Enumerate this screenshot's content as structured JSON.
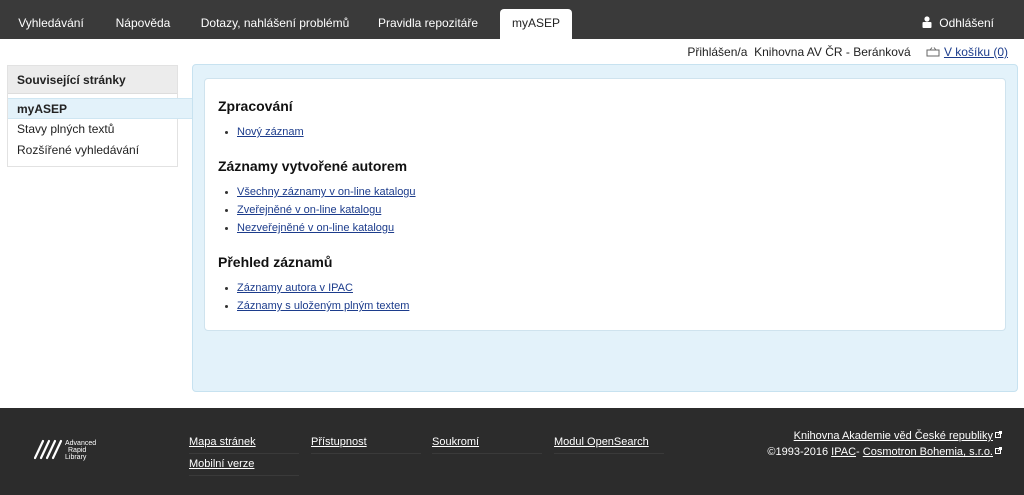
{
  "topnav": {
    "tabs": [
      {
        "label": "Vyhledávání"
      },
      {
        "label": "Nápověda"
      },
      {
        "label": "Dotazy, nahlášení problémů"
      },
      {
        "label": "Pravidla repozitáře"
      },
      {
        "label": "myASEP"
      }
    ],
    "logout_label": "Odhlášení"
  },
  "loginbar": {
    "logged_prefix": "Přihlášen/a",
    "user": "Knihovna AV ČR - Beránková",
    "cart_label": "V košíku (0)"
  },
  "sidebar": {
    "heading": "Související stránky",
    "items": [
      {
        "label": "myASEP"
      },
      {
        "label": "Stavy plných textů"
      },
      {
        "label": "Rozšířené vyhledávání"
      }
    ]
  },
  "main": {
    "sections": [
      {
        "heading": "Zpracování",
        "links": [
          "Nový záznam"
        ]
      },
      {
        "heading": "Záznamy vytvořené autorem",
        "links": [
          "Všechny záznamy v on-line katalogu",
          "Zveřejněné v on-line katalogu",
          "Nezveřejněné v on-line katalogu"
        ]
      },
      {
        "heading": "Přehled záznamů",
        "links": [
          "Záznamy autora v IPAC",
          "Záznamy s uloženým plným textem"
        ]
      }
    ]
  },
  "footer": {
    "logo_text": [
      "Advanced",
      "Rapid",
      "Library"
    ],
    "columns": [
      {
        "links": [
          "Mapa stránek",
          "Mobilní verze"
        ]
      },
      {
        "links": [
          "Přístupnost"
        ]
      },
      {
        "links": [
          "Soukromí"
        ]
      },
      {
        "links": [
          "Modul OpenSearch"
        ]
      }
    ],
    "library_link": "Knihovna Akademie věd České republiky",
    "copyright": "©1993-2016",
    "ipac_link": "IPAC",
    "separator": "-",
    "cosmotron_link": "Cosmotron Bohemia, s.r.o."
  }
}
